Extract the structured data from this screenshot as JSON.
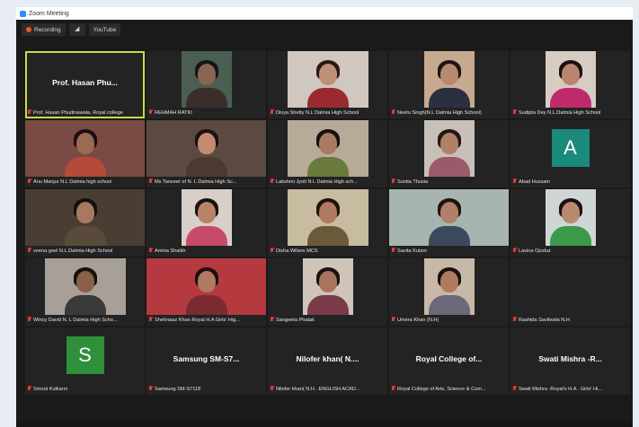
{
  "window": {
    "title": "Zoom Meeting"
  },
  "toolbar": {
    "recording_label": "Recording",
    "youtube_label": "YouTube"
  },
  "colors": {
    "active_border": "#c8d94a",
    "mic_muted": "#e23b3b",
    "avatar_a": "#1a8a7a",
    "avatar_s": "#2f8f3a"
  },
  "tiles": [
    {
      "label": "Prof. Hasan Phudinawala, Royal college",
      "big_name": "Prof. Hasan Phu...",
      "bg": "#232323",
      "active": true,
      "kind": "name"
    },
    {
      "label": "REHMAH RATKI",
      "bg": "#4a5e52",
      "skin": "#8a6652",
      "hair": "#151515",
      "shirt": "#3b2d2a",
      "kind": "video",
      "w": "small"
    },
    {
      "label": "Divya Shetty N.L Dalmia High School",
      "bg": "#cfc7c0",
      "skin": "#c09078",
      "hair": "#2a1a14",
      "shirt": "#9a2a2f",
      "kind": "video",
      "w": "mid"
    },
    {
      "label": "Neetu Singh(N.L Dalmia High School)",
      "bg": "#c7a990",
      "skin": "#b58a70",
      "hair": "#1e1410",
      "shirt": "#2a3040",
      "kind": "video",
      "w": "small"
    },
    {
      "label": "Sudipta Dey N.L.Dalmia High School",
      "bg": "#d6ccc2",
      "skin": "#b88670",
      "hair": "#1a120e",
      "shirt": "#c02a6a",
      "kind": "video",
      "w": "small"
    },
    {
      "label": "Anu Manjur N.L Dalmia high school",
      "bg": "#7a4a44",
      "skin": "#9a6a52",
      "hair": "#1a1010",
      "shirt": "#b44a38",
      "kind": "video",
      "w": "wide"
    },
    {
      "label": "Ms Tanveer of N. L Dalmia High Sc...",
      "bg": "#5a4a40",
      "skin": "#c48a70",
      "hair": "#1a1210",
      "shirt": "#4a3a30",
      "kind": "video",
      "w": "wide"
    },
    {
      "label": "Lakshmi Jyoti N L Dalmia High sch...",
      "bg": "#b8aa98",
      "skin": "#a87a60",
      "hair": "#181010",
      "shirt": "#6a7a3a",
      "kind": "video",
      "w": "mid"
    },
    {
      "label": "Sunita Thusia",
      "bg": "#c8c0b8",
      "skin": "#b08068",
      "hair": "#221612",
      "shirt": "#9a5a6a",
      "kind": "video",
      "w": "small"
    },
    {
      "label": "Abad Hussain",
      "avatar": "A",
      "avatar_color": "#1a8a7a",
      "bg": "#232323",
      "kind": "avatar"
    },
    {
      "label": "veena goel N.L.Dalmia High School",
      "bg": "#4a3e34",
      "skin": "#a87860",
      "hair": "#141010",
      "shirt": "#5a4a3a",
      "kind": "video",
      "w": "wide"
    },
    {
      "label": "Amina Shaikh",
      "bg": "#d8d0c8",
      "skin": "#b88468",
      "hair": "#1a1210",
      "shirt": "#c84a6a",
      "kind": "video",
      "w": "small"
    },
    {
      "label": "Disha Wilson MCS",
      "bg": "#c8bca0",
      "skin": "#b07a5e",
      "hair": "#1e1410",
      "shirt": "#6a5a3a",
      "kind": "video",
      "w": "mid"
    },
    {
      "label": "Savita Kutzer",
      "bg": "#a8b4b0",
      "skin": "#b08068",
      "hair": "#1e1410",
      "shirt": "#3a4a5a",
      "kind": "video",
      "w": "wide"
    },
    {
      "label": "Lavina Ojoduz",
      "bg": "#d0d6d4",
      "skin": "#b88a70",
      "hair": "#1a1210",
      "shirt": "#3a9a4a",
      "kind": "video",
      "w": "small"
    },
    {
      "label": "Wincy David N. L Dalmia High Scho...",
      "bg": "#a8a098",
      "skin": "#8a6048",
      "hair": "#141010",
      "shirt": "#3a3a3a",
      "kind": "video",
      "w": "mid"
    },
    {
      "label": "Shehnaaz Khan Royal H.A Girls' Hig...",
      "bg": "#b43a40",
      "skin": "#b07a60",
      "hair": "#1a1010",
      "shirt": "#7a2a30",
      "kind": "video",
      "w": "wide"
    },
    {
      "label": "Sangeeta Phatak",
      "bg": "#d0c4b8",
      "skin": "#a87460",
      "hair": "#1a1210",
      "shirt": "#7a3a4a",
      "kind": "video",
      "w": "small"
    },
    {
      "label": "Umera Khan (N.H)",
      "bg": "#c8b8a8",
      "skin": "#b07a60",
      "hair": "#1a1010",
      "shirt": "#6a6a7a",
      "kind": "video",
      "w": "small"
    },
    {
      "label": "Rashida Savliwala N.H",
      "bg": "#232323",
      "kind": "blank"
    },
    {
      "label": "Smruti Kulkarni",
      "avatar": "S",
      "avatar_color": "#2f8f3a",
      "bg": "#232323",
      "kind": "avatar"
    },
    {
      "label": "Samsung SM-S7118",
      "big_name": "Samsung SM-S7...",
      "bg": "#232323",
      "kind": "name"
    },
    {
      "label": "Nilofer khan( N.H . ENGLISH ACAD...",
      "big_name": "Nilofer khan( N....",
      "bg": "#232323",
      "kind": "name"
    },
    {
      "label": "Royal College of Arts, Science & Com...",
      "big_name": "Royal College of...",
      "bg": "#232323",
      "kind": "name"
    },
    {
      "label": "Swati Mishra -Royal's H.A . Girls' Hi...",
      "big_name": "Swati Mishra -R...",
      "bg": "#232323",
      "kind": "name"
    }
  ]
}
